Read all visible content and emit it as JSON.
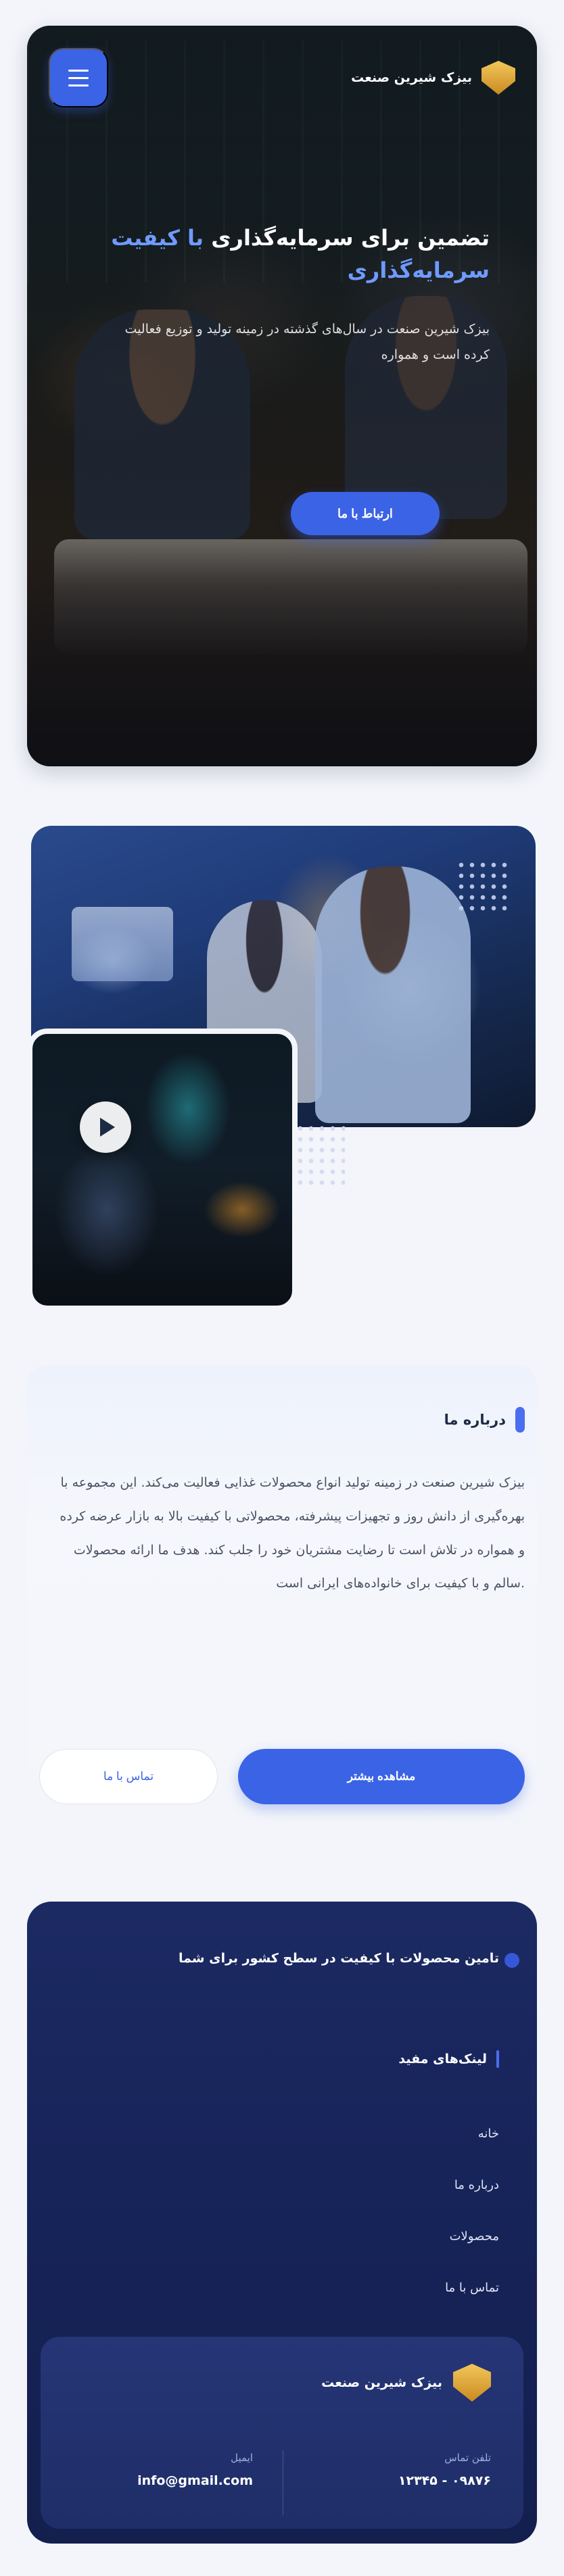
{
  "header": {
    "brand_name": "بیزک شیرین صنعت",
    "menu_icon": "hamburger-icon",
    "logo_icon": "shield-logo-icon"
  },
  "hero": {
    "title_line1": "تضمین برای سرمایه‌گذاری",
    "title_accent": "با کیفیت",
    "title_line2": "سرمایه‌گذاری",
    "description": "بیزک شیرین صنعت در سال‌های گذشته در زمینه تولید و توزیع فعالیت کرده است و همواره",
    "cta_label": "ارتباط با ما"
  },
  "collage": {
    "play_icon": "play-icon"
  },
  "about": {
    "label": "درباره ما",
    "text": "بیزک شیرین صنعت در زمینه تولید انواع محصولات غذایی فعالیت می‌کند. این مجموعه با بهره‌گیری از دانش روز و تجهیزات پیشرفته، محصولاتی با کیفیت بالا به بازار عرضه کرده و همواره در تلاش است تا رضایت مشتریان خود را جلب کند. هدف ما ارائه محصولات سالم و با کیفیت برای خانواده‌های ایرانی است.",
    "primary_button": "مشاهده بیشتر",
    "secondary_button": "تماس با ما"
  },
  "footer": {
    "tagline": "تامین محصولات با کیفیت در سطح کشور برای شما",
    "quick_links_title": "لینک‌های مفید",
    "links": [
      "خانه",
      "درباره ما",
      "محصولات",
      "تماس با ما"
    ],
    "card": {
      "brand_name": "بیزک شیرین صنعت",
      "phone_label": "تلفن تماس",
      "phone_value": "۱۲۳۴۵ - ۰۹۸۷۶",
      "email_label": "ایمیل",
      "email_value": "info@gmail.com"
    }
  },
  "colors": {
    "accent": "#3b63e6",
    "footer_bg": "#1c2a63",
    "page_bg": "#f3f5fa"
  }
}
